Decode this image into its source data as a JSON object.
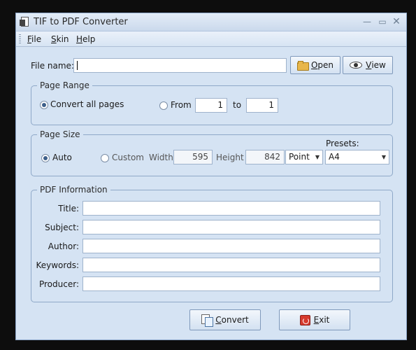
{
  "window": {
    "title": "TIF to PDF Converter",
    "min_glyph": "—",
    "max_glyph": "▭",
    "close_glyph": "✕"
  },
  "menu": {
    "file_key": "F",
    "file_rest": "ile",
    "skin_key": "S",
    "skin_rest": "kin",
    "help_key": "H",
    "help_rest": "elp"
  },
  "file": {
    "label": "File name:",
    "value": "",
    "open_key": "O",
    "open_rest": "pen",
    "view_key": "V",
    "view_rest": "iew"
  },
  "page_range": {
    "title": "Page Range",
    "convert_all": "Convert all pages",
    "from_label": "From",
    "from_value": "1",
    "to_label": "to",
    "to_value": "1",
    "selected": "convert_all"
  },
  "page_size": {
    "title": "Page Size",
    "auto_label": "Auto",
    "custom_label": "Custom",
    "width_label": "Width",
    "width_value": "595",
    "height_label": "Height",
    "height_value": "842",
    "unit_value": "Point",
    "presets_label": "Presets:",
    "preset_value": "A4",
    "selected": "auto"
  },
  "pdf_info": {
    "title": "PDF Information",
    "fields": [
      {
        "label": "Title:",
        "value": ""
      },
      {
        "label": "Subject:",
        "value": ""
      },
      {
        "label": "Author:",
        "value": ""
      },
      {
        "label": "Keywords:",
        "value": ""
      },
      {
        "label": "Producer:",
        "value": ""
      }
    ]
  },
  "actions": {
    "convert_key": "C",
    "convert_rest": "onvert",
    "exit_key": "E",
    "exit_rest": "xit"
  },
  "colors": {
    "window_bg": "#d5e3f3",
    "border": "#8ea8c8",
    "radio_dot": "#3d5f8a"
  },
  "icons": {
    "open": "folder-icon",
    "view": "eye-icon",
    "convert": "convert-icon",
    "exit": "exit-icon"
  }
}
